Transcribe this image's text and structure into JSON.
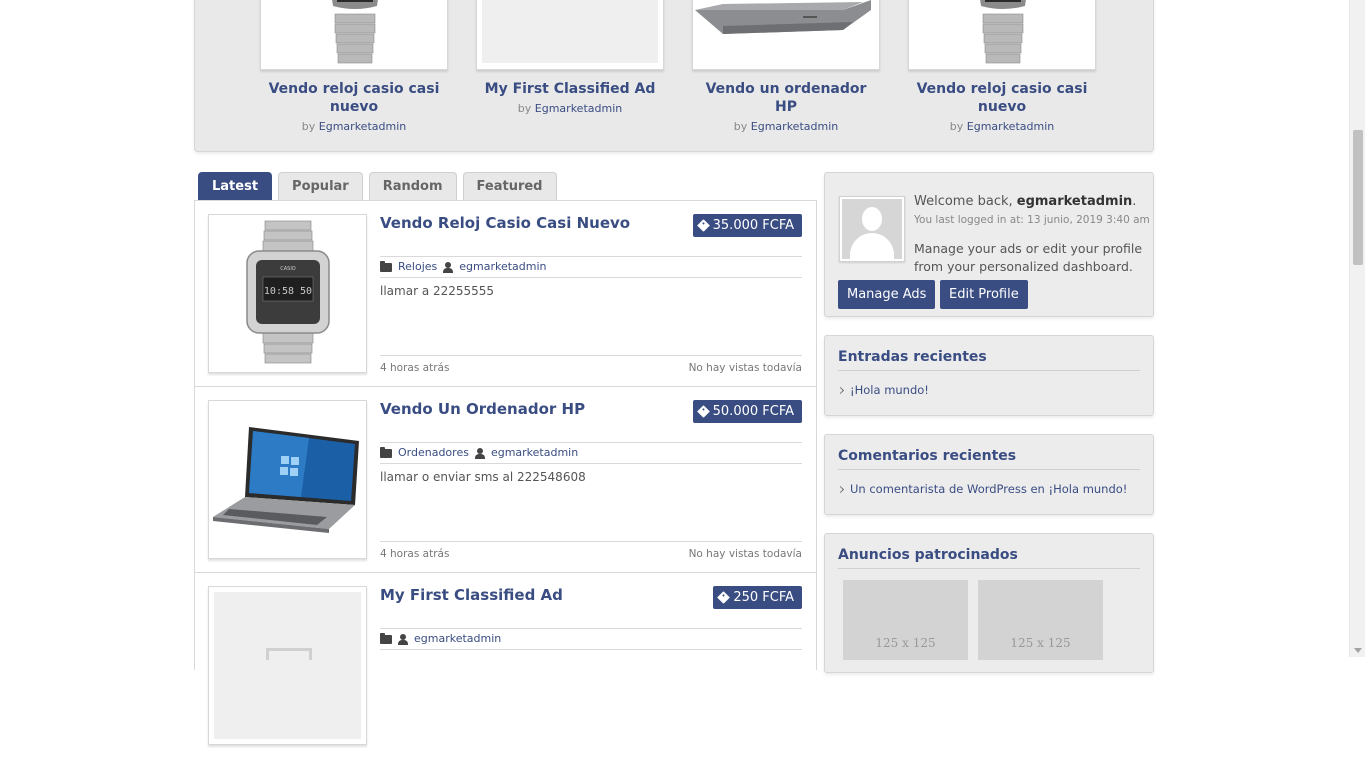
{
  "featured": [
    {
      "title": "Vendo reloj casio casi nuevo",
      "by": "by",
      "author": "Egmarketadmin",
      "image": "watch"
    },
    {
      "title": "My First Classified Ad",
      "by": "by",
      "author": "Egmarketadmin",
      "image": "placeholder"
    },
    {
      "title": "Vendo un ordenador HP",
      "by": "by",
      "author": "Egmarketadmin",
      "image": "laptop"
    },
    {
      "title": "Vendo reloj casio casi nuevo",
      "by": "by",
      "author": "Egmarketadmin",
      "image": "watch"
    }
  ],
  "tabs": [
    "Latest",
    "Popular",
    "Random",
    "Featured"
  ],
  "listings": [
    {
      "title": "Vendo Reloj Casio Casi Nuevo",
      "price": "35.000 FCFA",
      "category": "Relojes",
      "author": "egmarketadmin",
      "description": "llamar a 22255555",
      "time": "4 horas atrás",
      "views": "No hay vistas todavía",
      "image": "watch"
    },
    {
      "title": "Vendo Un Ordenador HP",
      "price": "50.000 FCFA",
      "category": "Ordenadores",
      "author": "egmarketadmin",
      "description": "llamar o enviar sms al 222548608",
      "time": "4 horas atrás",
      "views": "No hay vistas todavía",
      "image": "laptop"
    },
    {
      "title": "My First Classified Ad",
      "price": "250 FCFA",
      "category": "",
      "author": "egmarketadmin",
      "description": "",
      "time": "",
      "views": "",
      "image": "placeholder"
    }
  ],
  "welcome": {
    "greeting": "Welcome back,",
    "username": "egmarketadmin",
    "last_login": "You last logged in at: 13 junio, 2019 3:40 am",
    "description": "Manage your ads or edit your profile from your personalized dashboard.",
    "manage_label": "Manage Ads",
    "edit_label": "Edit Profile"
  },
  "recent_posts": {
    "title": "Entradas recientes",
    "items": [
      "¡Hola mundo!"
    ]
  },
  "recent_comments": {
    "title": "Comentarios recientes",
    "items": [
      "Un comentarista de WordPress en ¡Hola mundo!"
    ]
  },
  "sponsored": {
    "title": "Anuncios patrocinados",
    "slots": [
      "125 x 125",
      "125 x 125"
    ]
  },
  "colors": {
    "accent": "#3a4d82",
    "panel": "#ececed"
  }
}
